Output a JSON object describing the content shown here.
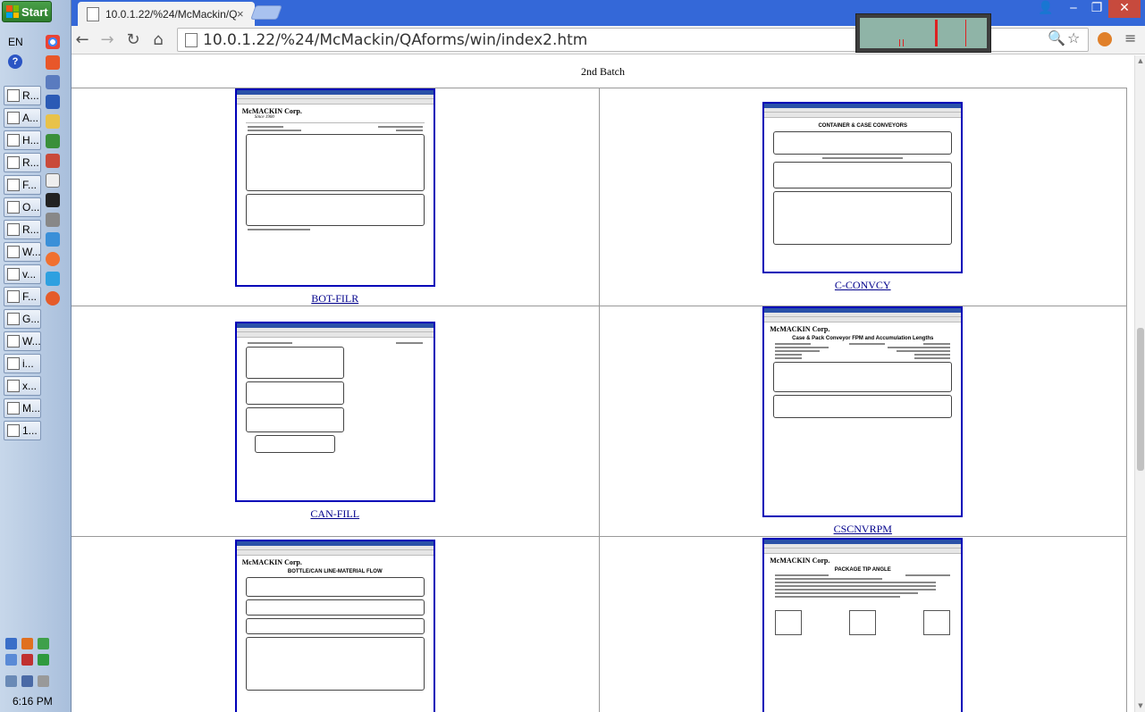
{
  "taskbar": {
    "start_label": "Start",
    "language": "EN",
    "help_glyph": "?",
    "buttons": [
      {
        "label": "R...",
        "icon": "document-icon"
      },
      {
        "label": "A...",
        "icon": "mail-icon"
      },
      {
        "label": "H...",
        "icon": "mail-icon"
      },
      {
        "label": "R...",
        "icon": "document-icon"
      },
      {
        "label": "F...",
        "icon": "document-icon"
      },
      {
        "label": "O...",
        "icon": "outlook-icon"
      },
      {
        "label": "R...",
        "icon": "document-icon"
      },
      {
        "label": "W...",
        "icon": "document-icon"
      },
      {
        "label": "v...",
        "icon": "mail-icon"
      },
      {
        "label": "F...",
        "icon": "document-icon"
      },
      {
        "label": "G...",
        "icon": "app-icon"
      },
      {
        "label": "W...",
        "icon": "folder-icon"
      },
      {
        "label": "i...",
        "icon": "image-icon"
      },
      {
        "label": "x...",
        "icon": "image-icon"
      },
      {
        "label": "M...",
        "icon": "app-icon"
      },
      {
        "label": "1...",
        "icon": "chrome-icon"
      }
    ],
    "clock": "6:16 PM"
  },
  "browser": {
    "tab_title": "10.0.1.22/%24/McMackin/QAforms/win/index2.htm",
    "tab_display": "10.0.1.22/%24/McMackin/Q",
    "url": "10.0.1.22/%24/McMackin/QAforms/win/index2.htm",
    "close_glyph": "×",
    "back_glyph": "←",
    "forward_glyph": "→",
    "reload_glyph": "↻",
    "home_glyph": "⌂",
    "zoom_glyph": "🔍",
    "star_glyph": "☆",
    "menu_glyph": "≡",
    "min_glyph": "‒",
    "restore_glyph": "❐",
    "win_close_glyph": "✕",
    "user_glyph": "👤"
  },
  "page": {
    "heading": "2nd Batch",
    "thumbnails": [
      {
        "link": "BOT-FILR"
      },
      {
        "link": "C-CONVCY"
      },
      {
        "link": "CAN-FILL"
      },
      {
        "link": "CSCNVRPM"
      },
      {
        "link": "",
        "title": "BOTTLE/CAN LINE-MATERIAL FLOW"
      },
      {
        "link": "",
        "title": "PACKAGE TIP ANGLE"
      }
    ],
    "thumb_texts": {
      "logo": "McMACKIN Corp.",
      "since": "Since 1900",
      "conveyors": "CONTAINER & CASE CONVEYORS",
      "cscnvrpm_title": "Case & Pack Conveyor FPM and Accumulation Lengths",
      "material_flow": "BOTTLE/CAN LINE-MATERIAL FLOW",
      "tip_angle": "PACKAGE TIP ANGLE"
    }
  },
  "colors": {
    "titlebar": "#3468d8",
    "link": "#00008b",
    "thumb_border": "#0000b8"
  }
}
